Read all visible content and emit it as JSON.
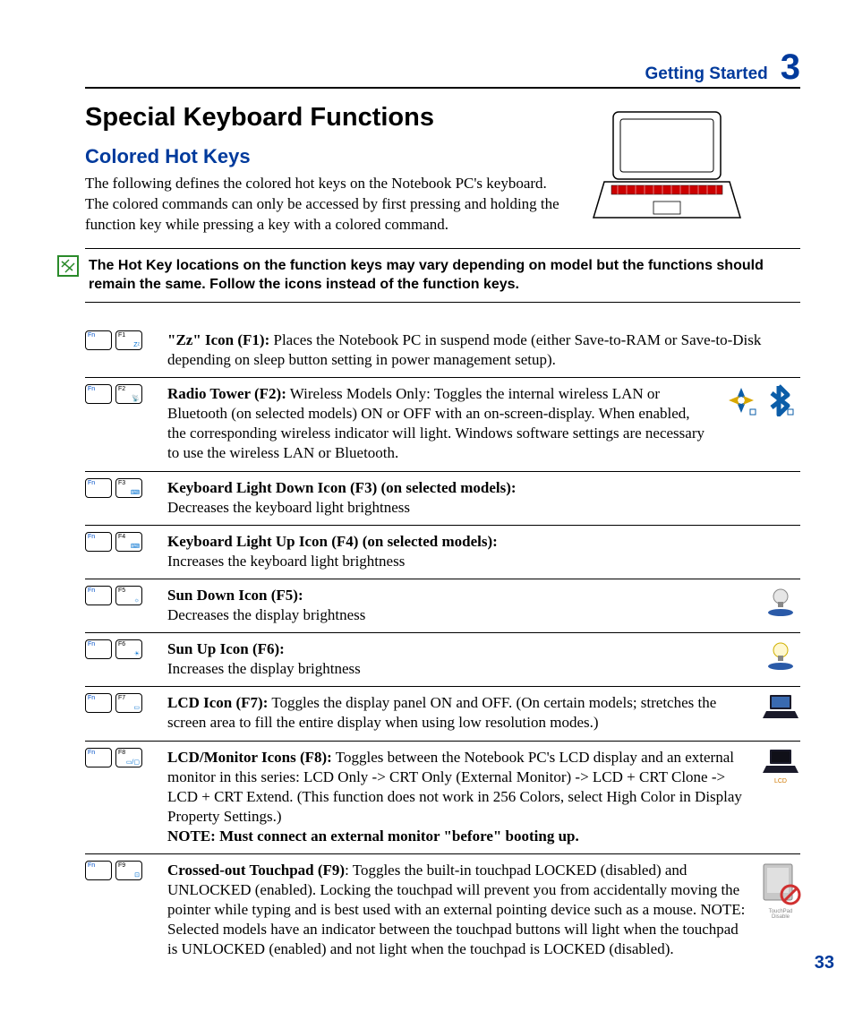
{
  "header": {
    "section": "Getting Started",
    "chapter": "3"
  },
  "h1": "Special Keyboard Functions",
  "h2": "Colored Hot Keys",
  "intro": "The following defines the colored hot keys on the Notebook PC's keyboard. The colored commands can only be accessed by first pressing and holding the function key while pressing a key with a colored command.",
  "note": "The Hot Key locations on the function keys may vary depending on model but the functions should remain the same. Follow the icons instead of the function keys.",
  "fn_label": "Fn",
  "rows": {
    "f1": {
      "key": "F1",
      "sub": "Zᶻ",
      "title": "\"Zz\" Icon (F1):",
      "body": " Places the Notebook PC in suspend mode (either Save-to-RAM or Save-to-Disk depending on sleep button setting in power management setup)."
    },
    "f2": {
      "key": "F2",
      "sub": "📡",
      "title": "Radio Tower (F2):",
      "body": " Wireless Models Only: Toggles the internal wireless LAN or Bluetooth (on selected models) ON or OFF with an on-screen-display. When enabled, the corresponding wireless indicator will light. Windows software settings are necessary to use the wireless LAN or Bluetooth."
    },
    "f3": {
      "key": "F3",
      "sub": "⌨",
      "title": "Keyboard Light Down Icon (F3) (on selected models):",
      "body": "Decreases the keyboard light brightness"
    },
    "f4": {
      "key": "F4",
      "sub": "⌨",
      "title": "Keyboard Light Up Icon (F4) (on selected models):",
      "body": "Increases the keyboard light brightness"
    },
    "f5": {
      "key": "F5",
      "sub": "☼",
      "title": "Sun Down Icon (F5):",
      "body": "Decreases the display brightness"
    },
    "f6": {
      "key": "F6",
      "sub": "☀",
      "title": "Sun Up Icon (F6):",
      "body": "Increases the display brightness"
    },
    "f7": {
      "key": "F7",
      "sub": "▭",
      "title": "LCD Icon (F7):",
      "body": " Toggles the display panel ON and OFF. (On certain models; stretches the screen area to fill the entire display when using low resolution modes.)"
    },
    "f8": {
      "key": "F8",
      "sub": "▭/▢",
      "title": "LCD/Monitor Icons (F8):",
      "body": " Toggles between the Notebook PC's LCD display and an external monitor in this series: LCD Only -> CRT Only (External Monitor) -> LCD + CRT Clone -> LCD + CRT Extend. (This function does not work in 256 Colors, select High Color in Display Property Settings.) ",
      "note": "NOTE: Must connect an external monitor \"before\" booting up.",
      "caption": "LCD"
    },
    "f9": {
      "key": "F9",
      "sub": "⊡",
      "title": "Crossed-out Touchpad (F9)",
      "body": ": Toggles the built-in touchpad LOCKED (disabled) and UNLOCKED (enabled). Locking the touchpad will prevent you from accidentally moving the pointer while typing and is best used with an external pointing device such as a mouse. NOTE: Selected models have an indicator between the touchpad buttons will light when the touchpad is UNLOCKED (enabled) and not light when the touchpad is LOCKED (disabled).",
      "caption": "TouchPad Disable"
    }
  },
  "page_number": "33"
}
